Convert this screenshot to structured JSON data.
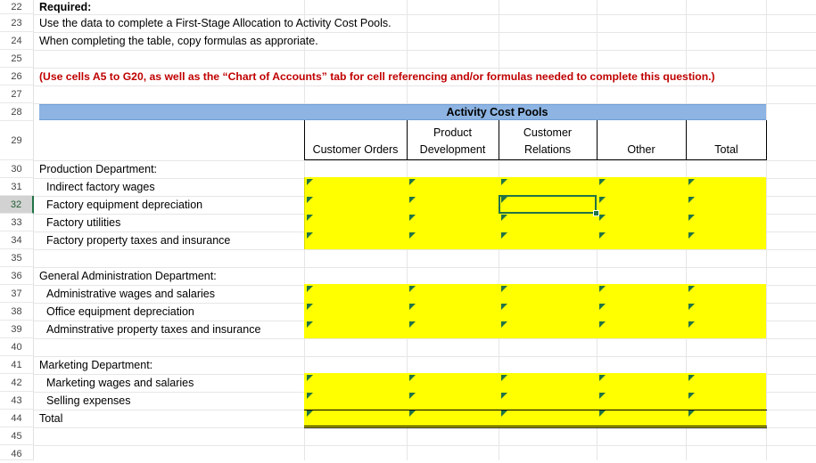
{
  "rows": [
    {
      "num": "22",
      "label": "Required:"
    },
    {
      "num": "23",
      "label": "Use the data to complete a First-Stage Allocation to Activity Cost Pools."
    },
    {
      "num": "24",
      "label": "When completing the table, copy formulas as approriate."
    },
    {
      "num": "25",
      "label": ""
    },
    {
      "num": "26",
      "label": "(Use cells A5 to G20, as well as the “Chart of Accounts” tab for cell referencing and/or formulas needed to complete this question.)"
    },
    {
      "num": "27",
      "label": ""
    },
    {
      "num": "28",
      "label": ""
    },
    {
      "num": "29",
      "label": ""
    },
    {
      "num": "30",
      "label": "Production Department:"
    },
    {
      "num": "31",
      "label": "Indirect factory wages"
    },
    {
      "num": "32",
      "label": "Factory equipment depreciation"
    },
    {
      "num": "33",
      "label": "Factory utilities"
    },
    {
      "num": "34",
      "label": "Factory property taxes and insurance"
    },
    {
      "num": "35",
      "label": ""
    },
    {
      "num": "36",
      "label": "General Administration Department:"
    },
    {
      "num": "37",
      "label": "Administrative wages and salaries"
    },
    {
      "num": "38",
      "label": "Office equipment depreciation"
    },
    {
      "num": "39",
      "label": "Adminstrative property taxes and insurance"
    },
    {
      "num": "40",
      "label": ""
    },
    {
      "num": "41",
      "label": "Marketing Department:"
    },
    {
      "num": "42",
      "label": "Marketing wages and salaries"
    },
    {
      "num": "43",
      "label": "Selling expenses"
    },
    {
      "num": "44",
      "label": "Total"
    },
    {
      "num": "45",
      "label": ""
    },
    {
      "num": "46",
      "label": ""
    }
  ],
  "selected_row": "32",
  "table": {
    "group_header": "Activity Cost Pools",
    "columns": [
      {
        "line1": "",
        "line2": "Customer Orders"
      },
      {
        "line1": "Product",
        "line2": "Development"
      },
      {
        "line1": "Customer",
        "line2": "Relations"
      },
      {
        "line1": "",
        "line2": "Other"
      },
      {
        "line1": "",
        "line2": "Total"
      }
    ]
  },
  "colors": {
    "header_band": "#8db4e2",
    "input_fill": "#ffff00",
    "indicator": "#217346",
    "note_text": "#c00000"
  }
}
